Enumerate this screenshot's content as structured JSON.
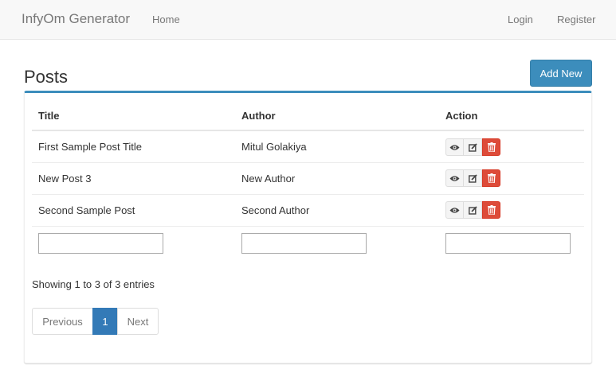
{
  "navbar": {
    "brand": "InfyOm Generator",
    "home": "Home",
    "login": "Login",
    "register": "Register"
  },
  "page": {
    "title": "Posts",
    "add_button": "Add New"
  },
  "table": {
    "headers": [
      "Title",
      "Author",
      "Action"
    ],
    "rows": [
      {
        "title": "First Sample Post Title",
        "author": "Mitul Golakiya"
      },
      {
        "title": "New Post 3",
        "author": "New Author"
      },
      {
        "title": "Second Sample Post",
        "author": "Second Author"
      }
    ],
    "info": "Showing 1 to 3 of 3 entries"
  },
  "pagination": {
    "previous": "Previous",
    "current": "1",
    "next": "Next"
  },
  "icons": {
    "view": "eye-icon",
    "edit": "edit-icon",
    "delete": "trash-icon"
  },
  "colors": {
    "primary": "#3c8dbc",
    "danger": "#dd4b39",
    "pagination_active": "#337ab7"
  }
}
